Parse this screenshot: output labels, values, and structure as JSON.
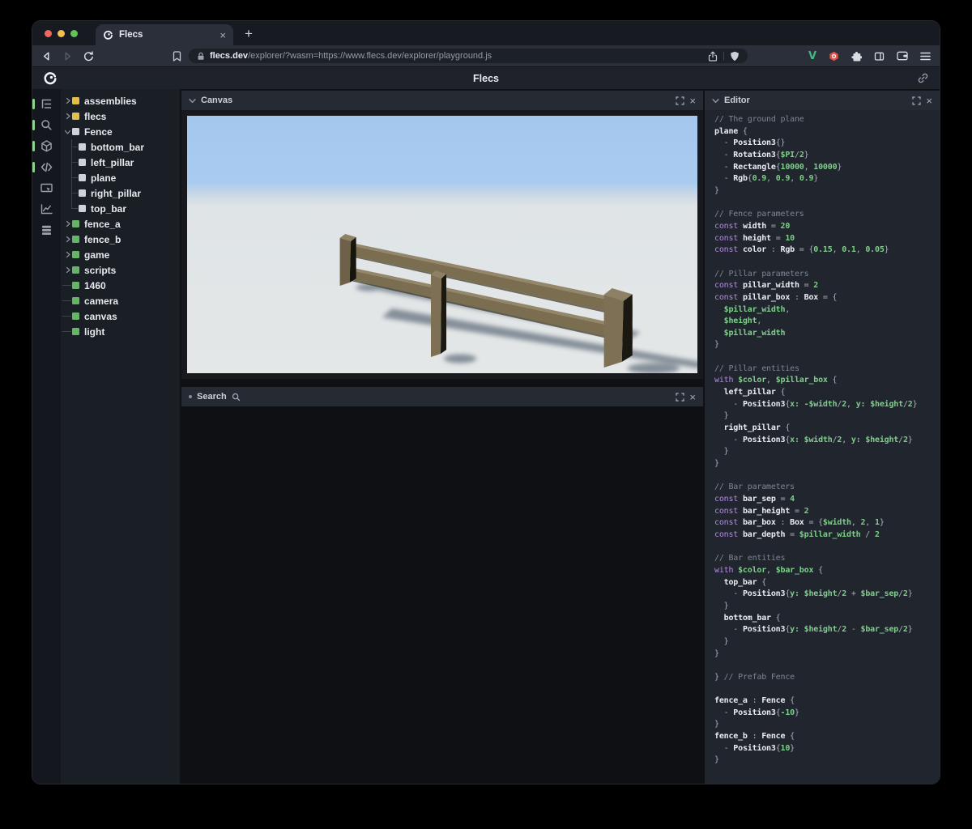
{
  "browser": {
    "tab_title": "Flecs",
    "close_tab_glyph": "×",
    "new_tab_glyph": "+",
    "url": {
      "host": "flecs.dev",
      "path": "/explorer/?wasm=https://www.flecs.dev/explorer/playground.js"
    },
    "toolbar_icons": [
      "back-icon",
      "forward-icon",
      "reload-icon",
      "bookmark-icon",
      "lock-icon",
      "share-icon",
      "brave-shield-icon",
      "vue-devtools-icon",
      "adblock-hexagon-icon",
      "extensions-puzzle-icon",
      "sidebar-toggle-icon",
      "wallet-icon",
      "menu-icon"
    ]
  },
  "app_header": {
    "title": "Flecs",
    "icons": [
      "flecs-logo-icon",
      "share-link-icon"
    ]
  },
  "sidebar": {
    "icons": [
      {
        "name": "entity-tree-icon",
        "active": true
      },
      {
        "name": "query-search-icon",
        "active": true
      },
      {
        "name": "inspector-cube-icon",
        "active": true
      },
      {
        "name": "script-editor-icon",
        "active": true
      },
      {
        "name": "canvas-screen-icon",
        "active": false
      },
      {
        "name": "statistics-chart-icon",
        "active": false
      },
      {
        "name": "data-tables-icon",
        "active": false
      }
    ],
    "tree": [
      {
        "label": "assemblies",
        "square": "yellow",
        "kind": "collapsed"
      },
      {
        "label": "flecs",
        "square": "yellow",
        "kind": "collapsed"
      },
      {
        "label": "Fence",
        "square": "white",
        "kind": "expanded"
      },
      {
        "label": "bottom_bar",
        "square": "white",
        "kind": "child",
        "last": false
      },
      {
        "label": "left_pillar",
        "square": "white",
        "kind": "child",
        "last": false
      },
      {
        "label": "plane",
        "square": "white",
        "kind": "child",
        "last": false
      },
      {
        "label": "right_pillar",
        "square": "white",
        "kind": "child",
        "last": false
      },
      {
        "label": "top_bar",
        "square": "white",
        "kind": "child",
        "last": true
      },
      {
        "label": "fence_a",
        "square": "green",
        "kind": "collapsed"
      },
      {
        "label": "fence_b",
        "square": "green",
        "kind": "collapsed"
      },
      {
        "label": "game",
        "square": "green",
        "kind": "collapsed"
      },
      {
        "label": "scripts",
        "square": "green",
        "kind": "collapsed"
      },
      {
        "label": "1460",
        "square": "green",
        "kind": "leaf"
      },
      {
        "label": "camera",
        "square": "green",
        "kind": "leaf"
      },
      {
        "label": "canvas",
        "square": "green",
        "kind": "leaf"
      },
      {
        "label": "light",
        "square": "green",
        "kind": "leaf"
      }
    ]
  },
  "panels": {
    "canvas": {
      "title": "Canvas"
    },
    "search": {
      "title": "Search"
    },
    "editor": {
      "title": "Editor"
    }
  },
  "editor": {
    "code_lines": [
      [
        [
          "c",
          "// The ground plane"
        ]
      ],
      [
        [
          "i",
          "plane"
        ],
        [
          "p",
          " {"
        ]
      ],
      [
        [
          "p",
          "  - "
        ],
        [
          "i",
          "Position3"
        ],
        [
          "p",
          "{}"
        ]
      ],
      [
        [
          "p",
          "  - "
        ],
        [
          "i",
          "Rotation3"
        ],
        [
          "p",
          "{"
        ],
        [
          "v",
          "$PI"
        ],
        [
          "p",
          "/"
        ],
        [
          "v",
          "2"
        ],
        [
          "p",
          "}"
        ]
      ],
      [
        [
          "p",
          "  - "
        ],
        [
          "i",
          "Rectangle"
        ],
        [
          "p",
          "{"
        ],
        [
          "v",
          "10000"
        ],
        [
          "p",
          ", "
        ],
        [
          "v",
          "10000"
        ],
        [
          "p",
          "}"
        ]
      ],
      [
        [
          "p",
          "  - "
        ],
        [
          "i",
          "Rgb"
        ],
        [
          "p",
          "{"
        ],
        [
          "v",
          "0.9"
        ],
        [
          "p",
          ", "
        ],
        [
          "v",
          "0.9"
        ],
        [
          "p",
          ", "
        ],
        [
          "v",
          "0.9"
        ],
        [
          "p",
          "}"
        ]
      ],
      [
        [
          "p",
          "}"
        ]
      ],
      [],
      [
        [
          "c",
          "// Fence parameters"
        ]
      ],
      [
        [
          "k",
          "const "
        ],
        [
          "i",
          "width"
        ],
        [
          "p",
          " = "
        ],
        [
          "v",
          "20"
        ]
      ],
      [
        [
          "k",
          "const "
        ],
        [
          "i",
          "height"
        ],
        [
          "p",
          " = "
        ],
        [
          "v",
          "10"
        ]
      ],
      [
        [
          "k",
          "const "
        ],
        [
          "i",
          "color"
        ],
        [
          "p",
          " : "
        ],
        [
          "i",
          "Rgb"
        ],
        [
          "p",
          " = {"
        ],
        [
          "v",
          "0.15"
        ],
        [
          "p",
          ", "
        ],
        [
          "v",
          "0.1"
        ],
        [
          "p",
          ", "
        ],
        [
          "v",
          "0.05"
        ],
        [
          "p",
          "}"
        ]
      ],
      [],
      [
        [
          "c",
          "// Pillar parameters"
        ]
      ],
      [
        [
          "k",
          "const "
        ],
        [
          "i",
          "pillar_width"
        ],
        [
          "p",
          " = "
        ],
        [
          "v",
          "2"
        ]
      ],
      [
        [
          "k",
          "const "
        ],
        [
          "i",
          "pillar_box"
        ],
        [
          "p",
          " : "
        ],
        [
          "i",
          "Box"
        ],
        [
          "p",
          " = {"
        ]
      ],
      [
        [
          "v",
          "  $pillar_width"
        ],
        [
          "p",
          ","
        ]
      ],
      [
        [
          "v",
          "  $height"
        ],
        [
          "p",
          ","
        ]
      ],
      [
        [
          "v",
          "  $pillar_width"
        ]
      ],
      [
        [
          "p",
          "}"
        ]
      ],
      [],
      [
        [
          "c",
          "// Pillar entities"
        ]
      ],
      [
        [
          "k",
          "with "
        ],
        [
          "v",
          "$color"
        ],
        [
          "p",
          ", "
        ],
        [
          "v",
          "$pillar_box"
        ],
        [
          "p",
          " {"
        ]
      ],
      [
        [
          "i",
          "  left_pillar"
        ],
        [
          "p",
          " {"
        ]
      ],
      [
        [
          "p",
          "    - "
        ],
        [
          "i",
          "Position3"
        ],
        [
          "p",
          "{"
        ],
        [
          "v",
          "x:"
        ],
        [
          "p",
          " "
        ],
        [
          "v",
          "-$width"
        ],
        [
          "p",
          "/"
        ],
        [
          "v",
          "2"
        ],
        [
          "p",
          ", "
        ],
        [
          "v",
          "y:"
        ],
        [
          "p",
          " "
        ],
        [
          "v",
          "$height"
        ],
        [
          "p",
          "/"
        ],
        [
          "v",
          "2"
        ],
        [
          "p",
          "}"
        ]
      ],
      [
        [
          "p",
          "  }"
        ]
      ],
      [
        [
          "i",
          "  right_pillar"
        ],
        [
          "p",
          " {"
        ]
      ],
      [
        [
          "p",
          "    - "
        ],
        [
          "i",
          "Position3"
        ],
        [
          "p",
          "{"
        ],
        [
          "v",
          "x:"
        ],
        [
          "p",
          " "
        ],
        [
          "v",
          "$width"
        ],
        [
          "p",
          "/"
        ],
        [
          "v",
          "2"
        ],
        [
          "p",
          ", "
        ],
        [
          "v",
          "y:"
        ],
        [
          "p",
          " "
        ],
        [
          "v",
          "$height"
        ],
        [
          "p",
          "/"
        ],
        [
          "v",
          "2"
        ],
        [
          "p",
          "}"
        ]
      ],
      [
        [
          "p",
          "  }"
        ]
      ],
      [
        [
          "p",
          "}"
        ]
      ],
      [],
      [
        [
          "c",
          "// Bar parameters"
        ]
      ],
      [
        [
          "k",
          "const "
        ],
        [
          "i",
          "bar_sep"
        ],
        [
          "p",
          " = "
        ],
        [
          "v",
          "4"
        ]
      ],
      [
        [
          "k",
          "const "
        ],
        [
          "i",
          "bar_height"
        ],
        [
          "p",
          " = "
        ],
        [
          "v",
          "2"
        ]
      ],
      [
        [
          "k",
          "const "
        ],
        [
          "i",
          "bar_box"
        ],
        [
          "p",
          " : "
        ],
        [
          "i",
          "Box"
        ],
        [
          "p",
          " = {"
        ],
        [
          "v",
          "$width"
        ],
        [
          "p",
          ", "
        ],
        [
          "v",
          "2"
        ],
        [
          "p",
          ", "
        ],
        [
          "v",
          "1"
        ],
        [
          "p",
          "}"
        ]
      ],
      [
        [
          "k",
          "const "
        ],
        [
          "i",
          "bar_depth"
        ],
        [
          "p",
          " = "
        ],
        [
          "v",
          "$pillar_width"
        ],
        [
          "p",
          " / "
        ],
        [
          "v",
          "2"
        ]
      ],
      [],
      [
        [
          "c",
          "// Bar entities"
        ]
      ],
      [
        [
          "k",
          "with "
        ],
        [
          "v",
          "$color"
        ],
        [
          "p",
          ", "
        ],
        [
          "v",
          "$bar_box"
        ],
        [
          "p",
          " {"
        ]
      ],
      [
        [
          "i",
          "  top_bar"
        ],
        [
          "p",
          " {"
        ]
      ],
      [
        [
          "p",
          "    - "
        ],
        [
          "i",
          "Position3"
        ],
        [
          "p",
          "{"
        ],
        [
          "v",
          "y:"
        ],
        [
          "p",
          " "
        ],
        [
          "v",
          "$height"
        ],
        [
          "p",
          "/"
        ],
        [
          "v",
          "2"
        ],
        [
          "p",
          " + "
        ],
        [
          "v",
          "$bar_sep"
        ],
        [
          "p",
          "/"
        ],
        [
          "v",
          "2"
        ],
        [
          "p",
          "}"
        ]
      ],
      [
        [
          "p",
          "  }"
        ]
      ],
      [
        [
          "i",
          "  bottom_bar"
        ],
        [
          "p",
          " {"
        ]
      ],
      [
        [
          "p",
          "    - "
        ],
        [
          "i",
          "Position3"
        ],
        [
          "p",
          "{"
        ],
        [
          "v",
          "y:"
        ],
        [
          "p",
          " "
        ],
        [
          "v",
          "$height"
        ],
        [
          "p",
          "/"
        ],
        [
          "v",
          "2"
        ],
        [
          "p",
          " - "
        ],
        [
          "v",
          "$bar_sep"
        ],
        [
          "p",
          "/"
        ],
        [
          "v",
          "2"
        ],
        [
          "p",
          "}"
        ]
      ],
      [
        [
          "p",
          "  }"
        ]
      ],
      [
        [
          "p",
          "}"
        ]
      ],
      [],
      [
        [
          "p",
          "} "
        ],
        [
          "c",
          "// Prefab Fence"
        ]
      ],
      [],
      [
        [
          "i",
          "fence_a"
        ],
        [
          "p",
          " : "
        ],
        [
          "i",
          "Fence"
        ],
        [
          "p",
          " {"
        ]
      ],
      [
        [
          "p",
          "  - "
        ],
        [
          "i",
          "Position3"
        ],
        [
          "p",
          "{"
        ],
        [
          "v",
          "-10"
        ],
        [
          "p",
          "}"
        ]
      ],
      [
        [
          "p",
          "}"
        ]
      ],
      [
        [
          "i",
          "fence_b"
        ],
        [
          "p",
          " : "
        ],
        [
          "i",
          "Fence"
        ],
        [
          "p",
          " {"
        ]
      ],
      [
        [
          "p",
          "  - "
        ],
        [
          "i",
          "Position3"
        ],
        [
          "p",
          "{"
        ],
        [
          "v",
          "10"
        ],
        [
          "p",
          "}"
        ]
      ],
      [
        [
          "p",
          "}"
        ]
      ]
    ]
  },
  "colors": {
    "active_indicator_green": "#8bd48f",
    "entity_green": "#64b564",
    "prefab_yellow": "#e5be45",
    "prefab_white": "#ced3da",
    "syntax_keyword": "#b48be0",
    "syntax_value": "#7ecf8a",
    "syntax_comment": "#7d8590",
    "sky_blue": "#a8cbf0",
    "ground_gray": "#e3e6e6",
    "fence_wood": "#7b6d50",
    "traffic_red": "#ee6a5f",
    "traffic_yellow": "#f5bf4f",
    "traffic_green": "#61c454"
  }
}
